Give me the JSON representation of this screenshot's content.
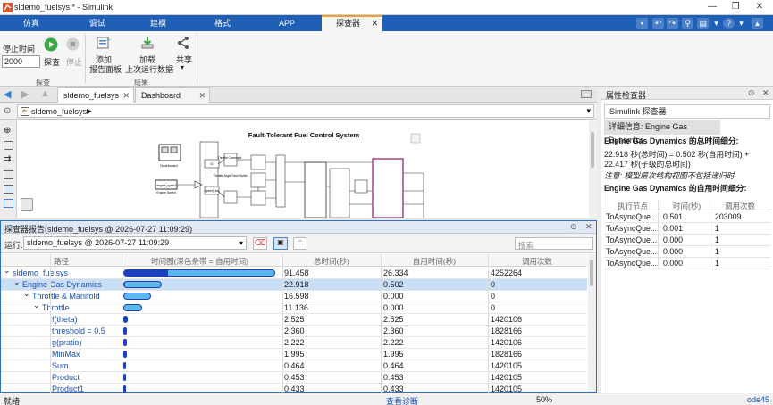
{
  "window": {
    "title": "sldemo_fuelsys * - Simulink"
  },
  "ribbon_tabs": [
    "仿真",
    "调试",
    "建模",
    "格式",
    "APP",
    "探查器"
  ],
  "ribbon": {
    "stop_time_label": "停止时间",
    "stop_time_value": "2000",
    "profile_label": "探查",
    "stop_label": "停止",
    "add_report_label_1": "添加",
    "add_report_label_2": "报告面板",
    "load_label_1": "加载",
    "load_label_2": "上次运行数据",
    "share_label": "共享",
    "group_profile": "探查",
    "group_results": "结果"
  },
  "doc_tabs": [
    "sldemo_fuelsys",
    "Dashboard"
  ],
  "address": {
    "model_path": "sldemo_fuelsys"
  },
  "canvas": {
    "diagram_title": "Fault-Tolerant Fuel Control System",
    "labels": {
      "dashboard": "Dashboard",
      "engine_speed": "engine_speed",
      "engine_speed_sub": "Engine Speed",
      "throttle_command": "Throttle Command",
      "throttle_single_fault": "Throttle Angle Fault Switch"
    }
  },
  "report": {
    "header": "探查器报告(sldemo_fuelsys @ 2026-07-27 11:09:29)",
    "run_label": "运行:",
    "run_value": "sldemo_fuelsys @ 2026-07-27 11:09:29",
    "search_placeholder": "搜索",
    "columns": [
      "路径",
      "时间图(深色条带 = 自用时间)",
      "总时间(秒)",
      "自用时间(秒)",
      "调用次数"
    ],
    "rows": [
      {
        "indent": 0,
        "expander": "⌄",
        "path": "sldemo_fuelsys",
        "total": "91.458",
        "self": "26.334",
        "calls": "4252264",
        "bar_total": 1.0,
        "bar_self": 0.288,
        "selected": false
      },
      {
        "indent": 1,
        "expander": "⌄",
        "path": "Engine Gas Dynamics",
        "total": "22.918",
        "self": "0.502",
        "calls": "0",
        "bar_total": 0.251,
        "bar_self": 0.005,
        "selected": true
      },
      {
        "indent": 2,
        "expander": "⌄",
        "path": "Throttle & Manifold",
        "total": "16.598",
        "self": "0.000",
        "calls": "0",
        "bar_total": 0.181,
        "bar_self": 0,
        "selected": false
      },
      {
        "indent": 3,
        "expander": "⌄",
        "path": "Throttle",
        "total": "11.136",
        "self": "0.000",
        "calls": "0",
        "bar_total": 0.122,
        "bar_self": 0,
        "selected": false
      },
      {
        "indent": 4,
        "expander": "",
        "path": "f(theta)",
        "total": "2.525",
        "self": "2.525",
        "calls": "1420106",
        "bar_total": 0.028,
        "bar_self": 0.028,
        "selected": false
      },
      {
        "indent": 4,
        "expander": "",
        "path": "threshold = 0.5",
        "total": "2.360",
        "self": "2.360",
        "calls": "1828166",
        "bar_total": 0.026,
        "bar_self": 0.026,
        "selected": false
      },
      {
        "indent": 4,
        "expander": "",
        "path": "g(pratio)",
        "total": "2.222",
        "self": "2.222",
        "calls": "1420106",
        "bar_total": 0.024,
        "bar_self": 0.024,
        "selected": false
      },
      {
        "indent": 4,
        "expander": "",
        "path": "MinMax",
        "total": "1.995",
        "self": "1.995",
        "calls": "1828166",
        "bar_total": 0.022,
        "bar_self": 0.022,
        "selected": false
      },
      {
        "indent": 4,
        "expander": "",
        "path": "Sum",
        "total": "0.464",
        "self": "0.464",
        "calls": "1420105",
        "bar_total": 0.005,
        "bar_self": 0.005,
        "selected": false
      },
      {
        "indent": 4,
        "expander": "",
        "path": "Product",
        "total": "0.453",
        "self": "0.453",
        "calls": "1420105",
        "bar_total": 0.005,
        "bar_self": 0.005,
        "selected": false
      },
      {
        "indent": 4,
        "expander": "",
        "path": "Product1",
        "total": "0.433",
        "self": "0.433",
        "calls": "1420105",
        "bar_total": 0.005,
        "bar_self": 0.005,
        "selected": false
      }
    ]
  },
  "inspector": {
    "title": "属性检查器",
    "tab1": "Simulink 探查器",
    "tab2": "详细信息: Engine Gas Dynamics",
    "total_heading": "Engine Gas Dynamics 的总时间细分:",
    "total_text": "22.918 秒(总时间) = 0.502 秒(自用时间) + 22.417 秒(子级的总时间)",
    "note": "注意: 模型层次结构视图不包括递归时",
    "self_heading": "Engine Gas Dynamics 的自用时间细分:",
    "table_headers": [
      "执行节点",
      "时间(秒)",
      "调用次数"
    ],
    "table_rows": [
      [
        "ToAsyncQue...",
        "0.501",
        "203009"
      ],
      [
        "ToAsyncQue...",
        "0.001",
        "1"
      ],
      [
        "ToAsyncQue...",
        "0.000",
        "1"
      ],
      [
        "ToAsyncQue...",
        "0.000",
        "1"
      ],
      [
        "ToAsyncQue...",
        "0.000",
        "1"
      ]
    ]
  },
  "status": {
    "left": "就绪",
    "link": "查看诊断",
    "zoom": "50%",
    "solver": "ode45"
  },
  "colors": {
    "accent": "#1f5fb6",
    "bar": "#5bb8e8",
    "bar_self": "#1a3fbf",
    "selected_row": "#c9dff7"
  }
}
